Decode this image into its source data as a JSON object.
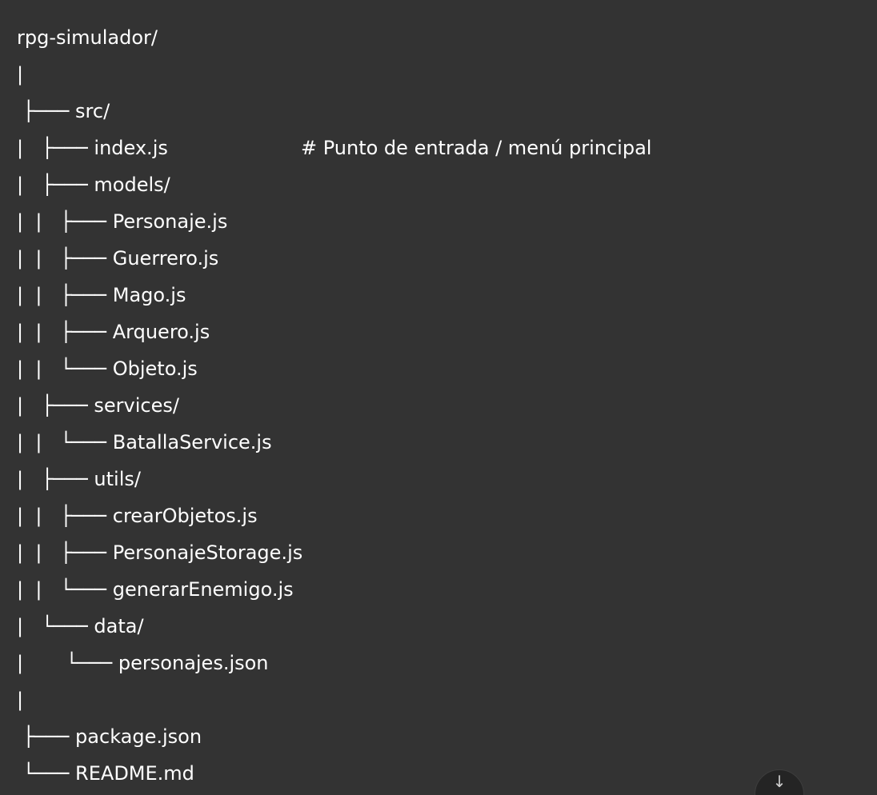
{
  "tree": {
    "lines": [
      {
        "text": "rpg-simulador/",
        "comment": ""
      },
      {
        "text": "|",
        "comment": ""
      },
      {
        "text": " ├─── src/",
        "comment": ""
      },
      {
        "text": "|   ├─── index.js",
        "comment": "# Punto de entrada / menú principal"
      },
      {
        "text": "|   ├─── models/",
        "comment": ""
      },
      {
        "text": "|  |   ├─── Personaje.js",
        "comment": ""
      },
      {
        "text": "|  |   ├─── Guerrero.js",
        "comment": ""
      },
      {
        "text": "|  |   ├─── Mago.js",
        "comment": ""
      },
      {
        "text": "|  |   ├─── Arquero.js",
        "comment": ""
      },
      {
        "text": "|  |   └─── Objeto.js",
        "comment": ""
      },
      {
        "text": "|   ├─── services/",
        "comment": ""
      },
      {
        "text": "|  |   └─── BatallaService.js",
        "comment": ""
      },
      {
        "text": "|   ├─── utils/",
        "comment": ""
      },
      {
        "text": "|  |   ├─── crearObjetos.js",
        "comment": ""
      },
      {
        "text": "|  |   ├─── PersonajeStorage.js",
        "comment": ""
      },
      {
        "text": "|  |   └─── generarEnemigo.js",
        "comment": ""
      },
      {
        "text": "|   └─── data/",
        "comment": ""
      },
      {
        "text": "|       └─── personajes.json",
        "comment": ""
      },
      {
        "text": "|",
        "comment": ""
      },
      {
        "text": " ├─── package.json",
        "comment": ""
      },
      {
        "text": " └─── README.md",
        "comment": ""
      }
    ]
  },
  "fab": {
    "icon": "scroll-down-icon",
    "glyph": "↓"
  }
}
